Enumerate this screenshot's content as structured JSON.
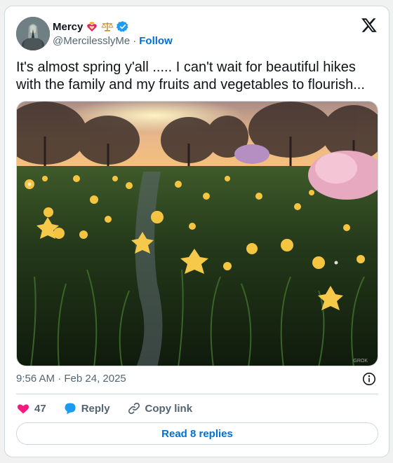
{
  "author": {
    "display_name": "Mercy",
    "handle": "@MercilesslyMe",
    "separator": "·",
    "follow_label": "Follow",
    "badges": [
      "flaming-heart-icon",
      "scales-icon",
      "verified-badge-icon"
    ]
  },
  "tweet": {
    "text": "It's almost spring y'all ..... I can't wait for beautiful hikes with the family and my fruits and vegetables to flourish...",
    "timestamp": "9:56 AM · Feb 24, 2025",
    "media": {
      "description_icon": "daffodil-field-image",
      "watermark": "GROK"
    }
  },
  "actions": {
    "like_count": "47",
    "reply_label": "Reply",
    "copy_link_label": "Copy link"
  },
  "footer": {
    "read_replies_label": "Read 8 replies"
  },
  "colors": {
    "accent": "#006fd6",
    "heart": "#f91880",
    "reply_bubble": "#1d9bf0",
    "verified": "#1d9bf0",
    "text_secondary": "#536471"
  }
}
